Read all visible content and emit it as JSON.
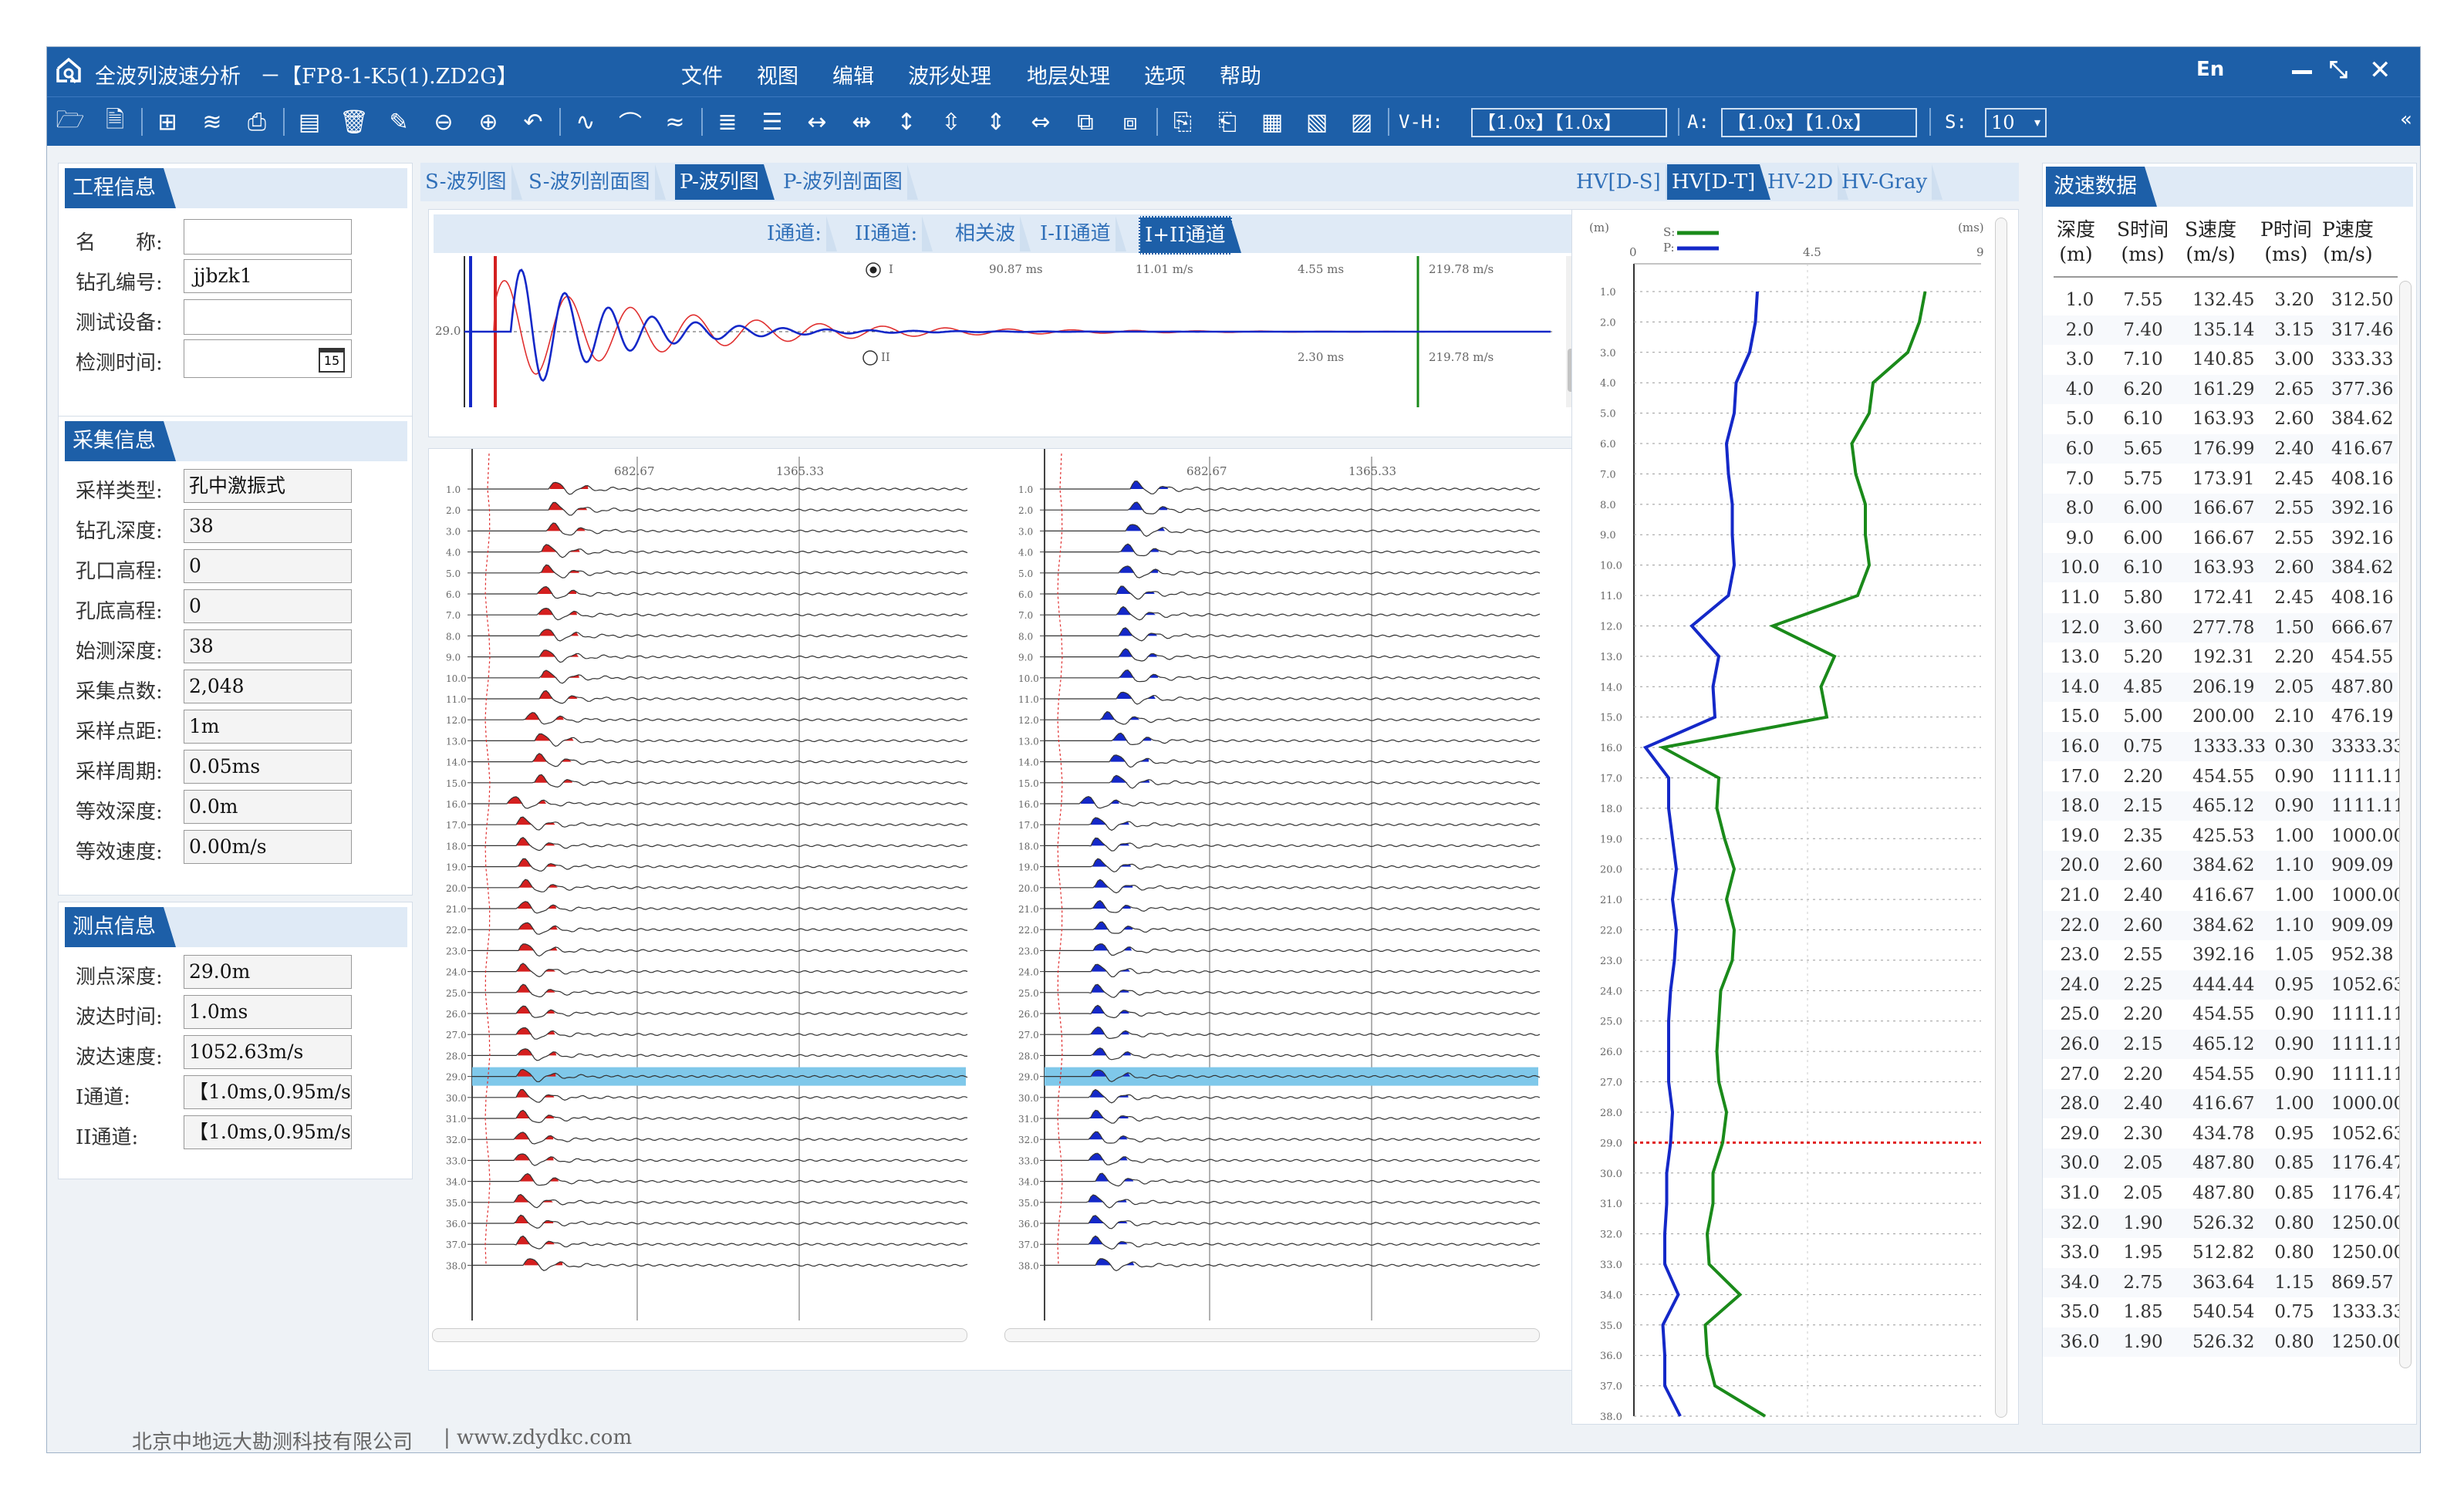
{
  "titlebar": {
    "app_title": "全波列波速分析",
    "file_title": "－【FP8-1-K5(1).ZD2G】",
    "menu": [
      "文件",
      "视图",
      "编辑",
      "波形处理",
      "地层处理",
      "选项",
      "帮助"
    ],
    "lang": "En"
  },
  "toolbar": {
    "vh_label": "V-H:",
    "vh_value": "【1.0x】【1.0x】",
    "a_label": "A:",
    "a_value": "【1.0x】【1.0x】",
    "s_label": "S:",
    "s_value": "10"
  },
  "project_info": {
    "title": "工程信息",
    "name_label": "名　　称:",
    "name_value": "",
    "hole_label": "钻孔编号:",
    "hole_value": "jjbzk1",
    "device_label": "测试设备:",
    "device_value": "",
    "date_label": "检测时间:",
    "date_value": "",
    "calendar_day": "15"
  },
  "acq_info": {
    "title": "采集信息",
    "rows": [
      {
        "label": "采样类型:",
        "value": "孔中激振式"
      },
      {
        "label": "钻孔深度:",
        "value": "38"
      },
      {
        "label": "孔口高程:",
        "value": "0"
      },
      {
        "label": "孔底高程:",
        "value": "0"
      },
      {
        "label": "始测深度:",
        "value": "38"
      },
      {
        "label": "采集点数:",
        "value": "2,048"
      },
      {
        "label": "采样点距:",
        "value": "1m"
      },
      {
        "label": "采样周期:",
        "value": "0.05ms"
      },
      {
        "label": "等效深度:",
        "value": "0.0m"
      },
      {
        "label": "等效速度:",
        "value": "0.00m/s"
      }
    ]
  },
  "point_info": {
    "title": "测点信息",
    "rows": [
      {
        "label": "测点深度:",
        "value": "29.0m"
      },
      {
        "label": "波达时间:",
        "value": "1.0ms"
      },
      {
        "label": "波达速度:",
        "value": "1052.63m/s"
      },
      {
        "label": "I通道:",
        "value": "【1.0ms,0.95m/s"
      },
      {
        "label": "II通道:",
        "value": "【1.0ms,0.95m/s"
      }
    ]
  },
  "wave_tabs": [
    "S-波列图",
    "S-波列剖面图",
    "P-波列图",
    "P-波列剖面图"
  ],
  "channel_tabs": [
    "I通道:",
    "II通道:",
    "相关波",
    "I-II通道",
    "I+II通道"
  ],
  "trace_detail": {
    "depth_label": "29.0",
    "radio_1": "I",
    "radio_2": "II",
    "r1_a": "90.87 ms",
    "r1_b": "11.01 m/s",
    "r1_c": "4.55 ms",
    "r1_d": "219.78 m/s",
    "r2_c": "2.30 ms",
    "r2_d": "219.78 m/s"
  },
  "wave_axis_ticks": [
    "682.67",
    "1365.33"
  ],
  "hv_tabs": [
    "HV[D-S]",
    "HV[D-T]",
    "HV-2D",
    "HV-Gray"
  ],
  "hv_chart": {
    "unit_left": "(m)",
    "unit_right": "(ms)",
    "x_ticks": [
      "0",
      "4.5",
      "9"
    ],
    "legend_s": "S:",
    "legend_p": "P:"
  },
  "speed_table": {
    "title": "波速数据",
    "headers": [
      [
        "深度",
        "(m)"
      ],
      [
        "S时间",
        "(ms)"
      ],
      [
        "S速度",
        "(m/s)"
      ],
      [
        "P时间",
        "(ms)"
      ],
      [
        "P速度",
        "(m/s)"
      ]
    ],
    "rows": [
      [
        "1.0",
        "7.55",
        "132.45",
        "3.20",
        "312.50"
      ],
      [
        "2.0",
        "7.40",
        "135.14",
        "3.15",
        "317.46"
      ],
      [
        "3.0",
        "7.10",
        "140.85",
        "3.00",
        "333.33"
      ],
      [
        "4.0",
        "6.20",
        "161.29",
        "2.65",
        "377.36"
      ],
      [
        "5.0",
        "6.10",
        "163.93",
        "2.60",
        "384.62"
      ],
      [
        "6.0",
        "5.65",
        "176.99",
        "2.40",
        "416.67"
      ],
      [
        "7.0",
        "5.75",
        "173.91",
        "2.45",
        "408.16"
      ],
      [
        "8.0",
        "6.00",
        "166.67",
        "2.55",
        "392.16"
      ],
      [
        "9.0",
        "6.00",
        "166.67",
        "2.55",
        "392.16"
      ],
      [
        "10.0",
        "6.10",
        "163.93",
        "2.60",
        "384.62"
      ],
      [
        "11.0",
        "5.80",
        "172.41",
        "2.45",
        "408.16"
      ],
      [
        "12.0",
        "3.60",
        "277.78",
        "1.50",
        "666.67"
      ],
      [
        "13.0",
        "5.20",
        "192.31",
        "2.20",
        "454.55"
      ],
      [
        "14.0",
        "4.85",
        "206.19",
        "2.05",
        "487.80"
      ],
      [
        "15.0",
        "5.00",
        "200.00",
        "2.10",
        "476.19"
      ],
      [
        "16.0",
        "0.75",
        "1333.33",
        "0.30",
        "3333.33"
      ],
      [
        "17.0",
        "2.20",
        "454.55",
        "0.90",
        "1111.11"
      ],
      [
        "18.0",
        "2.15",
        "465.12",
        "0.90",
        "1111.11"
      ],
      [
        "19.0",
        "2.35",
        "425.53",
        "1.00",
        "1000.00"
      ],
      [
        "20.0",
        "2.60",
        "384.62",
        "1.10",
        "909.09"
      ],
      [
        "21.0",
        "2.40",
        "416.67",
        "1.00",
        "1000.00"
      ],
      [
        "22.0",
        "2.60",
        "384.62",
        "1.10",
        "909.09"
      ],
      [
        "23.0",
        "2.55",
        "392.16",
        "1.05",
        "952.38"
      ],
      [
        "24.0",
        "2.25",
        "444.44",
        "0.95",
        "1052.63"
      ],
      [
        "25.0",
        "2.20",
        "454.55",
        "0.90",
        "1111.11"
      ],
      [
        "26.0",
        "2.15",
        "465.12",
        "0.90",
        "1111.11"
      ],
      [
        "27.0",
        "2.20",
        "454.55",
        "0.90",
        "1111.11"
      ],
      [
        "28.0",
        "2.40",
        "416.67",
        "1.00",
        "1000.00"
      ],
      [
        "29.0",
        "2.30",
        "434.78",
        "0.95",
        "1052.63"
      ],
      [
        "30.0",
        "2.05",
        "487.80",
        "0.85",
        "1176.47"
      ],
      [
        "31.0",
        "2.05",
        "487.80",
        "0.85",
        "1176.47"
      ],
      [
        "32.0",
        "1.90",
        "526.32",
        "0.80",
        "1250.00"
      ],
      [
        "33.0",
        "1.95",
        "512.82",
        "0.80",
        "1250.00"
      ],
      [
        "34.0",
        "2.75",
        "363.64",
        "1.15",
        "869.57"
      ],
      [
        "35.0",
        "1.85",
        "540.54",
        "0.75",
        "1333.33"
      ],
      [
        "36.0",
        "1.90",
        "526.32",
        "0.80",
        "1250.00"
      ]
    ]
  },
  "footer": {
    "company": "北京中地远大勘测科技有限公司",
    "site": "| www.zdydkc.com"
  },
  "colors": {
    "primary": "#1d5fa8",
    "s_line": "#1a8a1a",
    "p_line": "#1428c8",
    "highlight": "#7fc8ea"
  },
  "chart_data": {
    "type": "line",
    "xlim": [
      0,
      9
    ],
    "ylim": [
      1,
      38
    ],
    "series": [
      {
        "name": "S",
        "y": [
          1,
          2,
          3,
          4,
          5,
          6,
          7,
          8,
          9,
          10,
          11,
          12,
          13,
          14,
          15,
          16,
          17,
          18,
          19,
          20,
          21,
          22,
          23,
          24,
          25,
          26,
          27,
          28,
          29,
          30,
          31,
          32,
          33,
          34,
          35,
          36,
          37,
          38
        ],
        "x": [
          7.55,
          7.4,
          7.1,
          6.2,
          6.1,
          5.65,
          5.75,
          6.0,
          6.0,
          6.1,
          5.8,
          3.6,
          5.2,
          4.85,
          5.0,
          0.75,
          2.2,
          2.15,
          2.35,
          2.6,
          2.4,
          2.6,
          2.55,
          2.25,
          2.2,
          2.15,
          2.2,
          2.4,
          2.3,
          2.05,
          2.05,
          1.9,
          1.95,
          2.75,
          1.85,
          1.9,
          2.1,
          3.4
        ]
      },
      {
        "name": "P",
        "y": [
          1,
          2,
          3,
          4,
          5,
          6,
          7,
          8,
          9,
          10,
          11,
          12,
          13,
          14,
          15,
          16,
          17,
          18,
          19,
          20,
          21,
          22,
          23,
          24,
          25,
          26,
          27,
          28,
          29,
          30,
          31,
          32,
          33,
          34,
          35,
          36,
          37,
          38
        ],
        "x": [
          3.2,
          3.15,
          3.0,
          2.65,
          2.6,
          2.4,
          2.45,
          2.55,
          2.55,
          2.6,
          2.45,
          1.5,
          2.2,
          2.05,
          2.1,
          0.3,
          0.9,
          0.9,
          1.0,
          1.1,
          1.0,
          1.1,
          1.05,
          0.95,
          0.9,
          0.9,
          0.9,
          1.0,
          0.95,
          0.85,
          0.85,
          0.8,
          0.8,
          1.15,
          0.75,
          0.8,
          0.8,
          1.2
        ]
      }
    ],
    "marker_depth": 29
  }
}
